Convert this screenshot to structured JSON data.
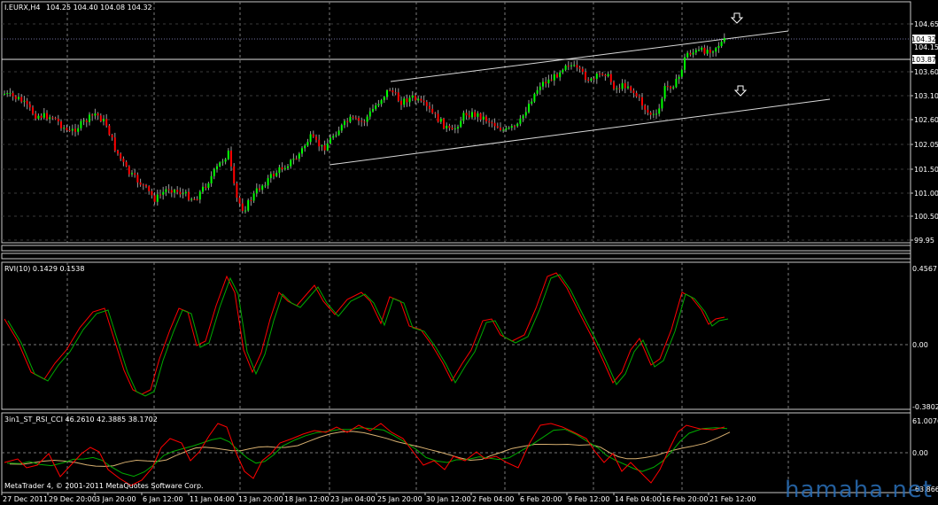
{
  "main": {
    "symbol_label": "I.EURX,H4",
    "ohlc_label": "104.25 104.40 104.08 104.32",
    "y_ticks": [
      "104.65",
      "103.60",
      "103.10",
      "102.60",
      "102.05",
      "101.50",
      "101.00",
      "100.50",
      "99.95"
    ],
    "price_badges": [
      "104.32",
      "104.15",
      "103.87"
    ],
    "colors": {
      "up": "#00ff00",
      "down": "#ff0000",
      "wick": "#9a9a9a",
      "grid": "#8a8a8a",
      "channel": "#d8d8d8",
      "dotted": "#6f6fa0"
    },
    "arrows": [
      "down-arrow-icon",
      "down-arrow-icon"
    ]
  },
  "rvi": {
    "label": "RVI(10) 0.1429 0.1538",
    "y_ticks": [
      "0.4567",
      "0.00",
      "-0.3802"
    ],
    "colors": {
      "main": "#ff0000",
      "signal": "#00aa00"
    }
  },
  "osc": {
    "label": "3in1_ST_RSI_CCI 46.2610 42.3885 38.1702",
    "y_ticks": [
      "61.0076",
      "0.00",
      "-63.8666"
    ],
    "colors": {
      "l1": "#ff0000",
      "l2": "#00aa00",
      "l3": "#d8b070"
    }
  },
  "x_axis": {
    "ticks": [
      "27 Dec 2011",
      "29 Dec 20:00",
      "3 Jan 20:00",
      "6 Jan 12:00",
      "11 Jan 04:00",
      "13 Jan 20:00",
      "18 Jan 12:00",
      "23 Jan 04:00",
      "25 Jan 20:00",
      "30 Jan 12:00",
      "2 Feb 04:00",
      "6 Feb 20:00",
      "9 Feb 12:00",
      "14 Feb 04:00",
      "16 Feb 20:00",
      "21 Feb 12:00"
    ]
  },
  "footer": {
    "copyright": "MetaTrader 4, © 2001-2011 MetaQuotes Software Corp."
  },
  "watermark": "hamaha.net"
}
